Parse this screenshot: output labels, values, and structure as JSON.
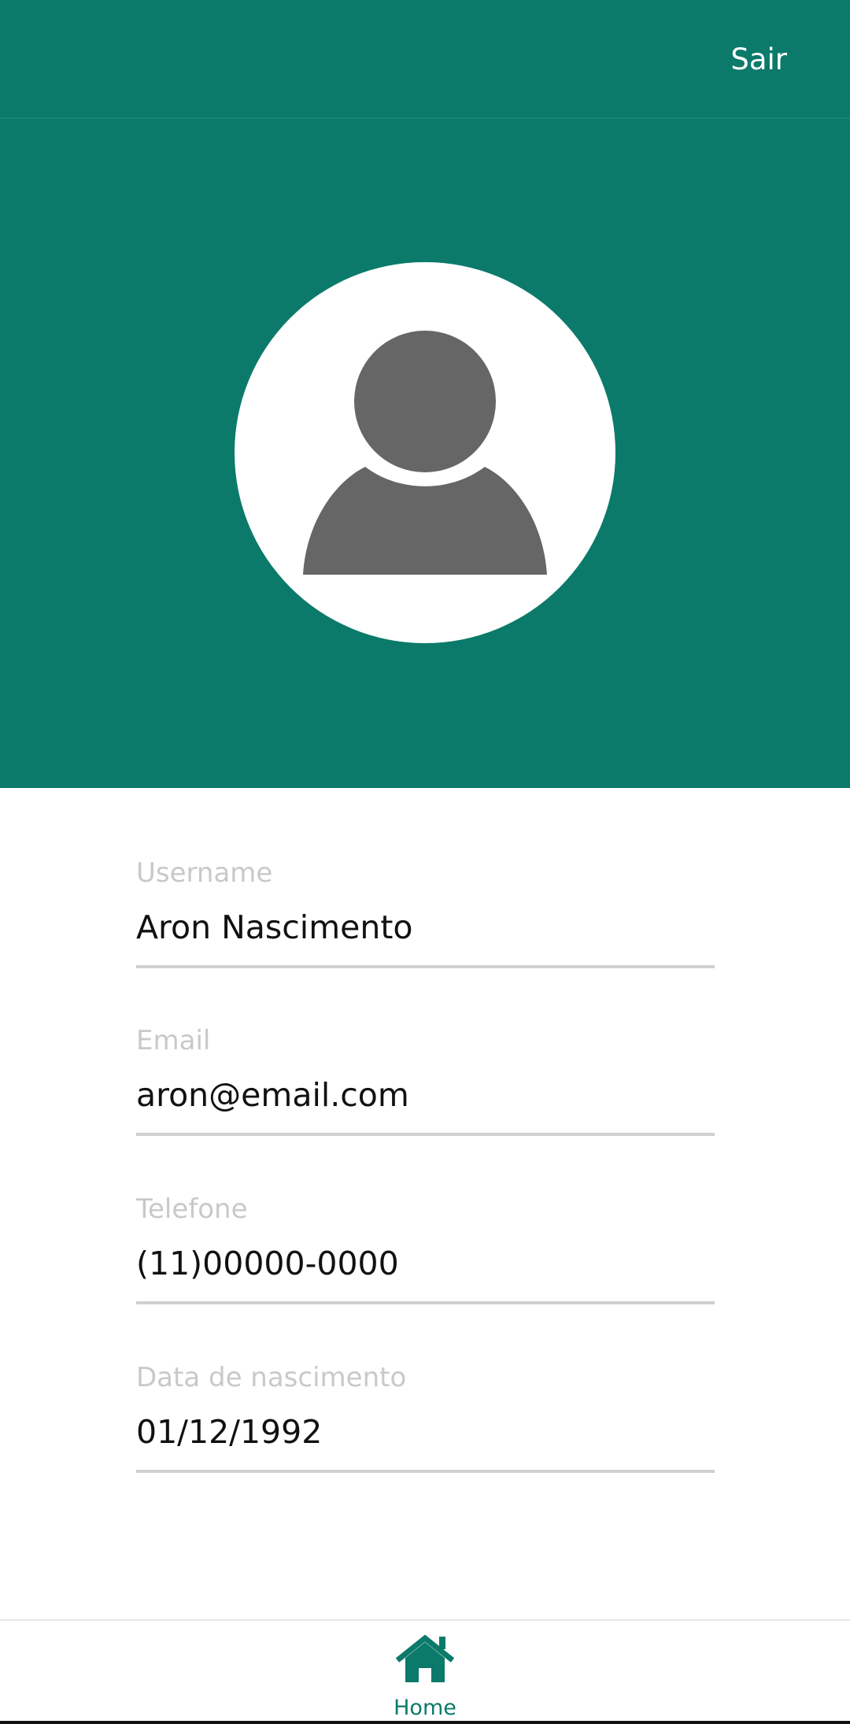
{
  "app_bar": {
    "logout_label": "Sair",
    "background_color": "#0b7a6a"
  },
  "profile": {
    "avatar_icon": "person-icon"
  },
  "fields": [
    {
      "label": "Username",
      "value": "Aron Nascimento"
    },
    {
      "label": "Email",
      "value": "aron@email.com"
    },
    {
      "label": "Telefone",
      "value": "(11)00000-0000"
    },
    {
      "label": "Data de nascimento",
      "value": "01/12/1992"
    }
  ],
  "bottom_nav": {
    "items": [
      {
        "label": "Home",
        "icon": "home-icon",
        "active": true
      }
    ],
    "active_color": "#0b7a6a"
  }
}
